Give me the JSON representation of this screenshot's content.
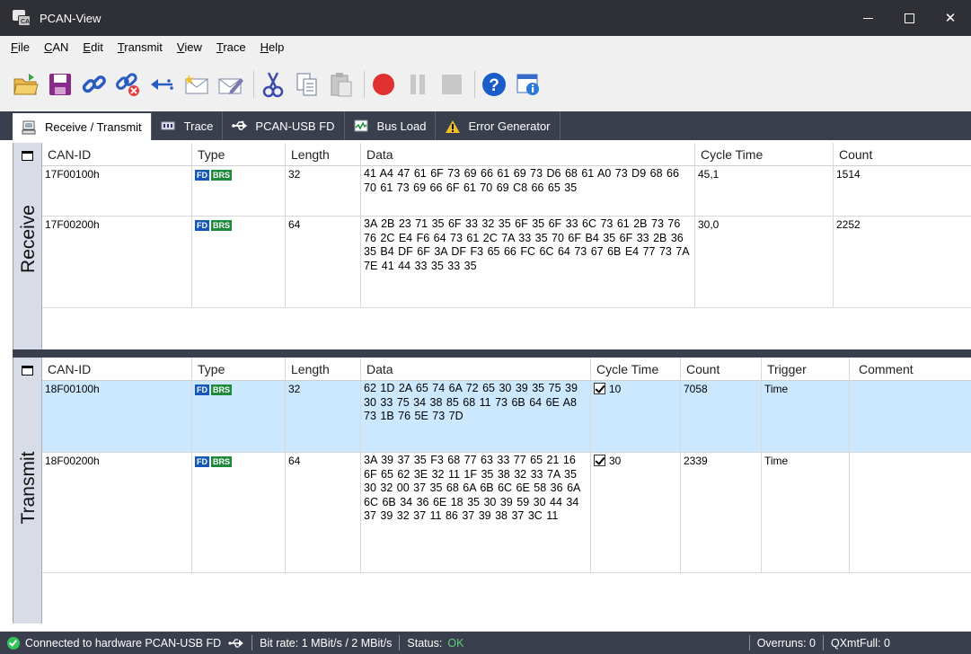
{
  "window": {
    "title": "PCAN-View"
  },
  "menu": [
    "File",
    "CAN",
    "Edit",
    "Transmit",
    "View",
    "Trace",
    "Help"
  ],
  "toolbar_icons": [
    "open-icon",
    "save-icon",
    "connect-icon",
    "disconnect-icon",
    "reset-icon",
    "new-message-icon",
    "edit-message-icon",
    "cut-icon",
    "copy-icon",
    "paste-icon",
    "record-icon",
    "pause-icon",
    "stop-icon",
    "help-icon",
    "about-icon"
  ],
  "tabs": [
    {
      "label": "Receive / Transmit",
      "icon": "monitor-icon",
      "active": true
    },
    {
      "label": "Trace",
      "icon": "trace-icon",
      "active": false
    },
    {
      "label": "PCAN-USB FD",
      "icon": "usb-icon",
      "active": false
    },
    {
      "label": "Bus Load",
      "icon": "chart-icon",
      "active": false
    },
    {
      "label": "Error Generator",
      "icon": "warning-icon",
      "active": false
    }
  ],
  "receive": {
    "side_label": "Receive",
    "headers": {
      "can_id": "CAN-ID",
      "type": "Type",
      "length": "Length",
      "data": "Data",
      "cycle_time": "Cycle Time",
      "count": "Count"
    },
    "rows": [
      {
        "can_id": "17F00100h",
        "type": [
          "FD",
          "BRS"
        ],
        "length": "32",
        "data": "41 A4 47 61 6F 73 69 66 61 69 73 D6 68 61 A0 73 D9 68 66 70 61 73 69 66 6F 61 70 69 C8 66 65 35",
        "cycle_time": "45,1",
        "count": "1514"
      },
      {
        "can_id": "17F00200h",
        "type": [
          "FD",
          "BRS"
        ],
        "length": "64",
        "data": "3A 2B 23 71 35 6F 33 32 35 6F 35 6F 33 6C 73 61 2B 73 76 76 2C E4 F6 64 73 61 2C 7A 33 35 70 6F B4 35 6F 33 2B 36 35 B4 DF 6F 3A DF F3 65 66 FC 6C 64 73 67 6B E4 77 73 7A 7E 41 44 33 35 33 35",
        "cycle_time": "30,0",
        "count": "2252"
      }
    ]
  },
  "transmit": {
    "side_label": "Transmit",
    "headers": {
      "can_id": "CAN-ID",
      "type": "Type",
      "length": "Length",
      "data": "Data",
      "cycle_time": "Cycle Time",
      "count": "Count",
      "trigger": "Trigger",
      "comment": "Comment"
    },
    "rows": [
      {
        "can_id": "18F00100h",
        "type": [
          "FD",
          "BRS"
        ],
        "length": "32",
        "data": "62 1D 2A 65 74 6A 72 65 30 39 35 75 39 30 33 75 34 38 85 68 11 73 6B 64 6E A8 73 1B 76 5E 73 7D",
        "cycle_checked": true,
        "cycle_time": "10",
        "count": "7058",
        "trigger": "Time",
        "comment": ""
      },
      {
        "can_id": "18F00200h",
        "type": [
          "FD",
          "BRS"
        ],
        "length": "64",
        "data": "3A 39 37 35 F3 68 77 63 33 77 65 21 16 6F 65 62 3E 32 11 1F 35 38 32 33 7A 35 30 32 00 37 35 68 6A 6B 6C 6E 58 36 6A 6C 6B 34 36 6E 18 35 30 39 59 30 44 34 37 39 32 37 11 86 37 39 38 37 3C 11",
        "cycle_checked": true,
        "cycle_time": "30",
        "count": "2339",
        "trigger": "Time",
        "comment": ""
      }
    ]
  },
  "status": {
    "connected": "Connected to hardware PCAN-USB FD",
    "bitrate": "Bit rate: 1 MBit/s / 2 MBit/s",
    "status_label": "Status:",
    "status_value": "OK",
    "overruns": "Overruns: 0",
    "qxmtfull": "QXmtFull: 0"
  },
  "colors": {
    "titlebar": "#2e3036",
    "panel_dark": "#3a3f4d",
    "selected_row": "#cce8ff",
    "side_label_bg": "#d8dce6",
    "status_ok": "#5fd07a",
    "fd_badge": "#1558b8",
    "brs_badge": "#1e8a3a"
  }
}
